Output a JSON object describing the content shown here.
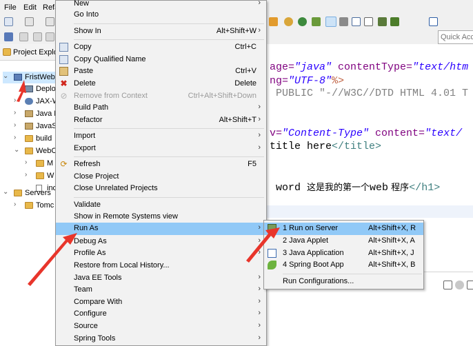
{
  "menubar": {
    "items": [
      "File",
      "Edit",
      "Refa"
    ]
  },
  "quick_access": {
    "placeholder": "Quick Acce"
  },
  "explorer": {
    "title": "Project Explo",
    "tree": [
      {
        "label": "FristWeb",
        "name": "tree-project-fristweb"
      },
      {
        "label": "Deplo",
        "name": "tree-deployment"
      },
      {
        "label": "JAX-W",
        "name": "tree-jax-ws"
      },
      {
        "label": "Java R",
        "name": "tree-java-resources"
      },
      {
        "label": "JavaS",
        "name": "tree-javascript"
      },
      {
        "label": "build",
        "name": "tree-build"
      },
      {
        "label": "WebC",
        "name": "tree-webcontent"
      },
      {
        "label": "M",
        "name": "tree-meta-inf"
      },
      {
        "label": "W",
        "name": "tree-web-inf"
      },
      {
        "label": "inc",
        "name": "tree-index-file"
      },
      {
        "label": "Servers",
        "name": "tree-servers"
      },
      {
        "label": "Tomc",
        "name": "tree-tomcat"
      }
    ]
  },
  "editor": {
    "line1": {
      "a": "age=",
      "b": "\"java\"",
      "c": " contentType=",
      "d": "\"text/htm"
    },
    "line2": {
      "a": "ng=",
      "b": "\"UTF-8\"",
      "c": "%>"
    },
    "line3": {
      "a": " PUBLIC ",
      "b": "\"-//W3C//DTD HTML 4.01 T"
    },
    "line4": {
      "a": "v=",
      "b": "\"Content-Type\"",
      "c": " content=",
      "d": "\"text/"
    },
    "line5": {
      "a": "title here",
      "b": "</title>"
    },
    "line6": {
      "a": " word ",
      "b": "这是我的第一个",
      "c": "web",
      "d": " 程序",
      "e": "</h1>"
    }
  },
  "context_menu": {
    "new": {
      "label": "New"
    },
    "go_into": {
      "label": "Go Into"
    },
    "show_in": {
      "label": "Show In",
      "shortcut": "Alt+Shift+W"
    },
    "copy": {
      "label": "Copy",
      "shortcut": "Ctrl+C"
    },
    "copy_qualified": {
      "label": "Copy Qualified Name"
    },
    "paste": {
      "label": "Paste",
      "shortcut": "Ctrl+V"
    },
    "delete": {
      "label": "Delete",
      "shortcut": "Delete"
    },
    "remove_context": {
      "label": "Remove from Context",
      "shortcut": "Ctrl+Alt+Shift+Down"
    },
    "build_path": {
      "label": "Build Path"
    },
    "refactor": {
      "label": "Refactor",
      "shortcut": "Alt+Shift+T"
    },
    "import": {
      "label": "Import"
    },
    "export": {
      "label": "Export"
    },
    "refresh": {
      "label": "Refresh",
      "shortcut": "F5"
    },
    "close_project": {
      "label": "Close Project"
    },
    "close_unrelated": {
      "label": "Close Unrelated Projects"
    },
    "validate": {
      "label": "Validate"
    },
    "show_remote": {
      "label": "Show in Remote Systems view"
    },
    "run_as": {
      "label": "Run As"
    },
    "debug_as": {
      "label": "Debug As"
    },
    "profile_as": {
      "label": "Profile As"
    },
    "restore_history": {
      "label": "Restore from Local History..."
    },
    "java_ee_tools": {
      "label": "Java EE Tools"
    },
    "team": {
      "label": "Team"
    },
    "compare_with": {
      "label": "Compare With"
    },
    "configure": {
      "label": "Configure"
    },
    "source": {
      "label": "Source"
    },
    "spring_tools": {
      "label": "Spring Tools"
    }
  },
  "run_as_submenu": {
    "run_on_server": {
      "label": "1 Run on Server",
      "shortcut": "Alt+Shift+X, R"
    },
    "java_applet": {
      "label": "2 Java Applet",
      "shortcut": "Alt+Shift+X, A"
    },
    "java_application": {
      "label": "3 Java Application",
      "shortcut": "Alt+Shift+X, J"
    },
    "spring_boot_app": {
      "label": "4 Spring Boot App",
      "shortcut": "Alt+Shift+X, B"
    },
    "run_configurations": {
      "label": "Run Configurations..."
    }
  },
  "colors": {
    "highlight": "#91c9f7",
    "menu_bg": "#f2f2f2",
    "arrow": "#e8352b"
  }
}
